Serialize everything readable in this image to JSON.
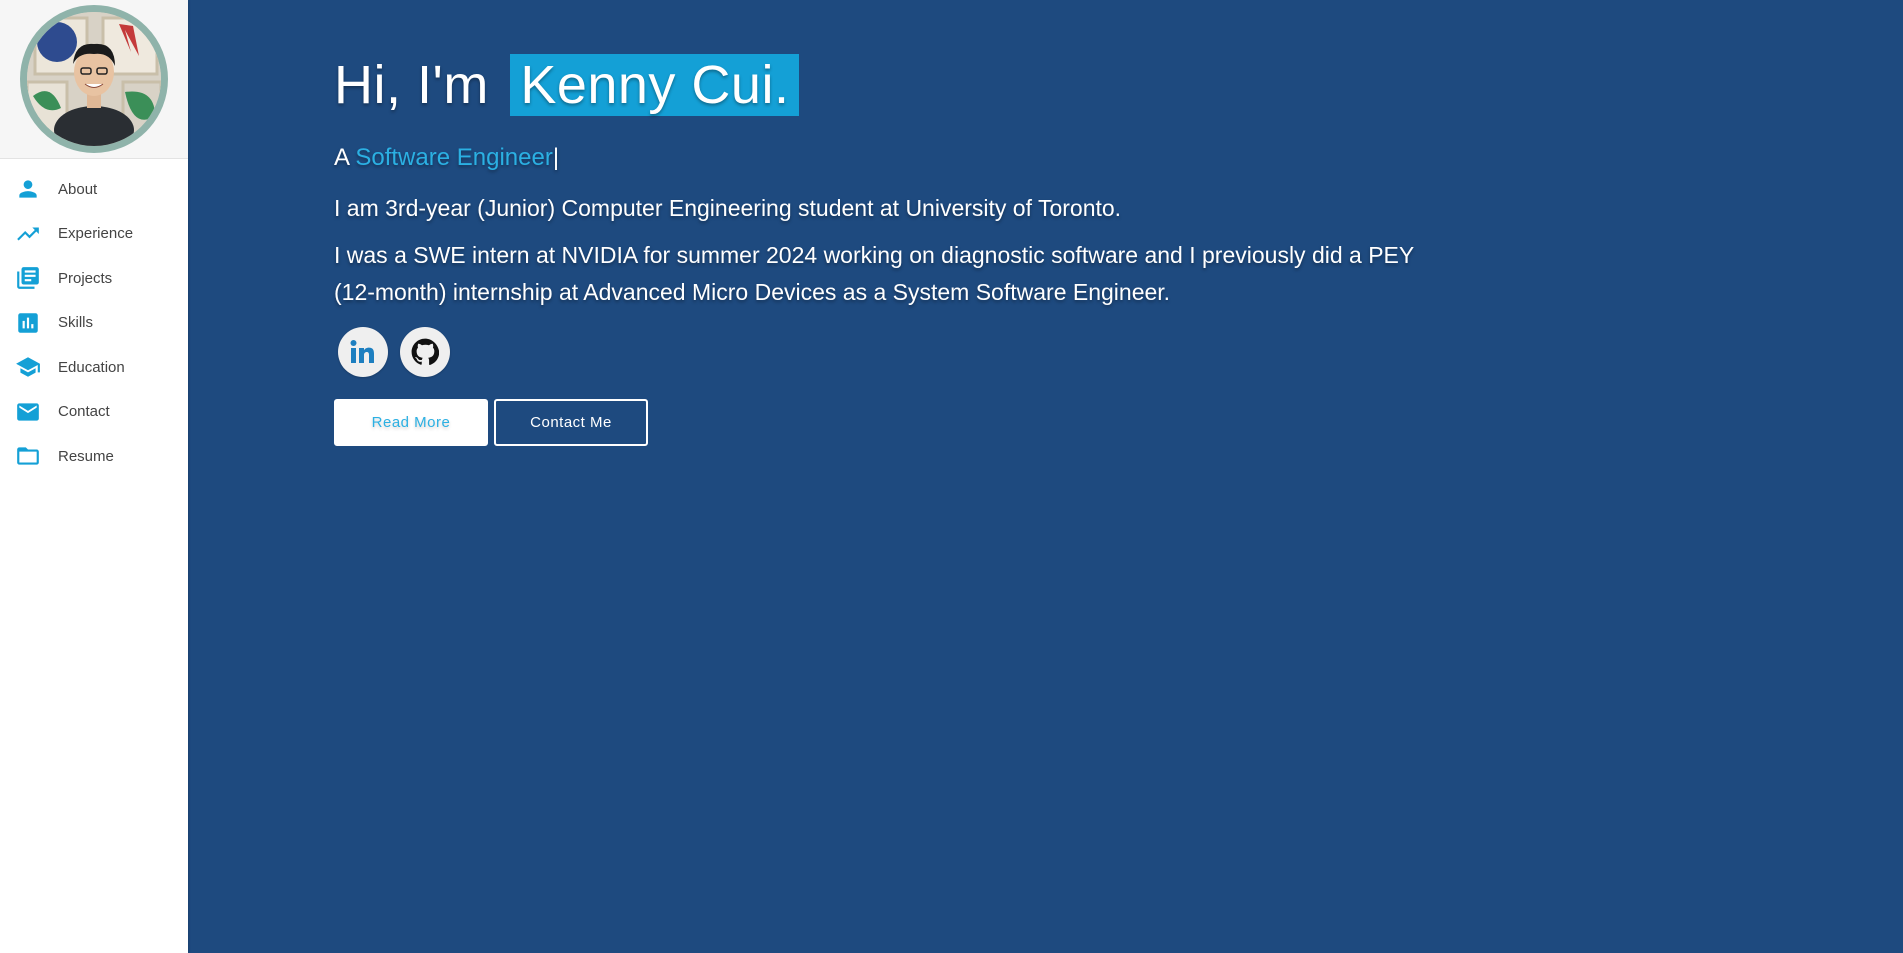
{
  "sidebar": {
    "avatar_alt": "Profile photo",
    "items": [
      {
        "label": "About",
        "icon": "person-icon"
      },
      {
        "label": "Experience",
        "icon": "trending-up-icon"
      },
      {
        "label": "Projects",
        "icon": "library-books-icon"
      },
      {
        "label": "Skills",
        "icon": "bar-chart-icon"
      },
      {
        "label": "Education",
        "icon": "school-icon"
      },
      {
        "label": "Contact",
        "icon": "mail-icon"
      },
      {
        "label": "Resume",
        "icon": "folder-icon"
      }
    ]
  },
  "hero": {
    "greeting": "Hi, I'm",
    "name": "Kenny Cui.",
    "subtitle_prefix": "A",
    "role": "Software Engineer",
    "cursor": "|",
    "paragraph1": "I am 3rd-year (Junior) Computer Engineering student at University of Toronto.",
    "paragraph2": "I was a SWE intern at NVIDIA for summer 2024 working on diagnostic software and I previously did a PEY (12-month) internship at Advanced Micro Devices as a System Software Engineer."
  },
  "socials": [
    {
      "name": "linkedin-icon",
      "label": "in"
    },
    {
      "name": "github-icon"
    }
  ],
  "buttons": {
    "read_more": "Read More",
    "contact_me": "Contact Me"
  },
  "colors": {
    "background": "#1e4a7f",
    "accent": "#14a0d6",
    "sidebar": "#ffffff"
  }
}
